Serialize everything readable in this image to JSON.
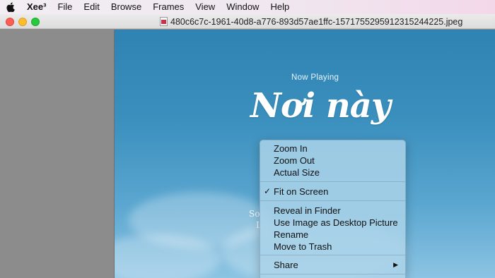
{
  "menubar": {
    "apple_icon": "apple-logo-icon",
    "app_name": "Xee³",
    "items": [
      "File",
      "Edit",
      "Browse",
      "Frames",
      "View",
      "Window",
      "Help"
    ]
  },
  "window": {
    "title": "480c6c7c-1961-40d8-a776-893d57ae1ffc-1571755295912315244225.jpeg",
    "title_icon": "jpeg-document-icon"
  },
  "photo": {
    "now_playing": "Now Playing",
    "song_title_line1": "Nơi này",
    "text_fragment_1": "So",
    "text_fragment_2": "L"
  },
  "context_menu": {
    "group1": [
      "Zoom In",
      "Zoom Out",
      "Actual Size"
    ],
    "group2": [
      "Fit on Screen"
    ],
    "group2_checked": "Fit on Screen",
    "group3": [
      "Reveal in Finder",
      "Use Image as Desktop Picture",
      "Rename",
      "Move to Trash"
    ],
    "group4": [
      "Share"
    ]
  },
  "colors": {
    "close": "#fd5f57",
    "minimize": "#febc2e",
    "maximize": "#28c840",
    "sky": "#3a8fbd",
    "menu_bg": "#aad3e9"
  }
}
